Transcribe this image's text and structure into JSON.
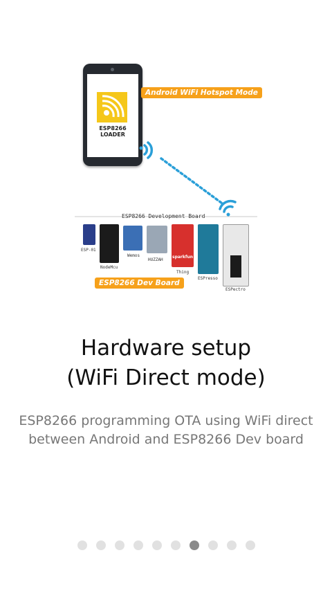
{
  "illustration": {
    "phone_logo_line1": "ESP8266",
    "phone_logo_line2": "LOADER",
    "hotspot_tag": "Android WiFi Hotspot Mode",
    "board_section_title": "ESP8266 Development Board",
    "boards": [
      "ESP-01",
      "NodeMcu",
      "Wemos",
      "HUZZAH",
      "Thing",
      "ESPresso",
      "ESPectro"
    ],
    "board_brand": "sparkfun",
    "dev_board_tag": "ESP8266 Dev Board",
    "colors": {
      "tag": "#f6a11b",
      "wifi": "#2a9fd8",
      "logo": "#f5c71a"
    }
  },
  "headline": {
    "line1": "Hardware setup",
    "line2": "(WiFi Direct mode)"
  },
  "description": "ESP8266 programming OTA using WiFi direct between Android and ESP8266 Dev board",
  "pager": {
    "total": 10,
    "active_index": 6
  }
}
